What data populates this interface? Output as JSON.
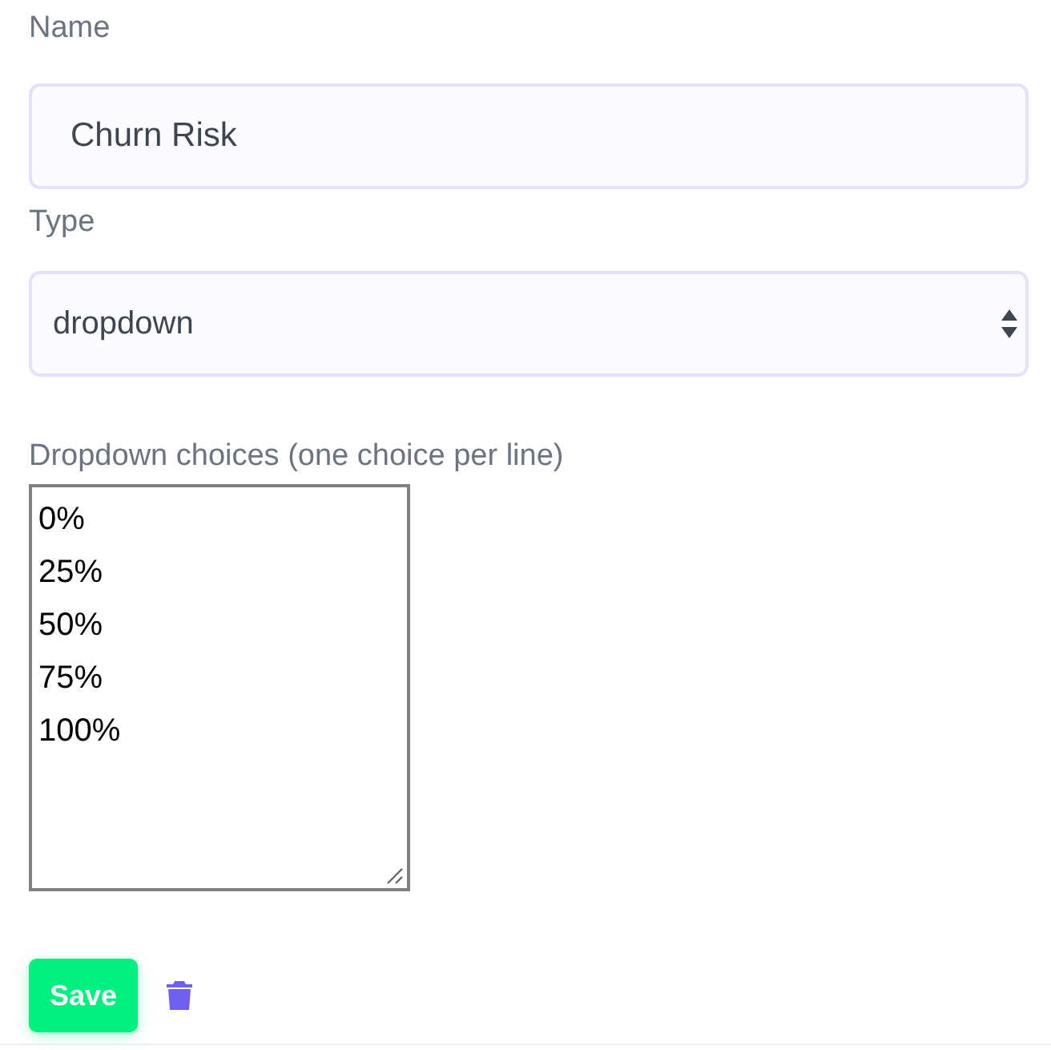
{
  "name_field": {
    "label": "Name",
    "value": "Churn Risk"
  },
  "type_field": {
    "label": "Type",
    "value": "dropdown"
  },
  "choices_field": {
    "label": "Dropdown choices (one choice per line)",
    "lines": [
      "0%",
      "25%",
      "50%",
      "75%",
      "100%"
    ]
  },
  "buttons": [
    {
      "kind": "save",
      "label": "Save"
    },
    {
      "kind": "delete"
    }
  ]
}
